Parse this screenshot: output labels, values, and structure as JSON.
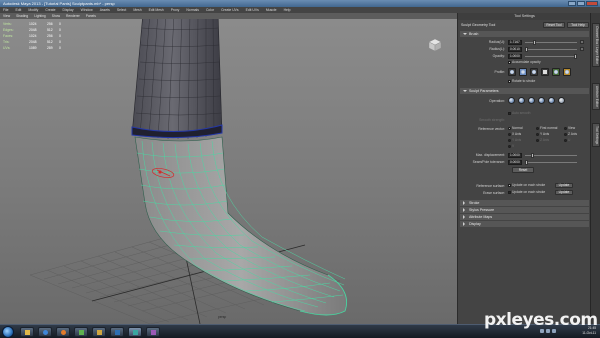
{
  "window": {
    "title": "Autodesk Maya 2013 - [Tutorial Pants] Sculptpants.mb* - persp"
  },
  "menubar": {
    "items": [
      "File",
      "Edit",
      "Modify",
      "Create",
      "Display",
      "Window",
      "Assets",
      "Select",
      "Mesh",
      "Edit Mesh",
      "Proxy",
      "Normals",
      "Color",
      "Create UVs",
      "Edit UVs",
      "Muscle",
      "Help"
    ]
  },
  "viewport": {
    "menu": [
      "View",
      "Shading",
      "Lighting",
      "Show",
      "Renderer",
      "Panels"
    ],
    "hud": [
      {
        "label": "Verts:",
        "a": "1024",
        "b": "256",
        "c": "0"
      },
      {
        "label": "Edges:",
        "a": "2048",
        "b": "512",
        "c": "0"
      },
      {
        "label": "Faces:",
        "a": "1024",
        "b": "256",
        "c": "0"
      },
      {
        "label": "Tris:",
        "a": "2048",
        "b": "512",
        "c": "0"
      },
      {
        "label": "UVs:",
        "a": "1089",
        "b": "289",
        "c": "0"
      }
    ],
    "camera_label": "persp",
    "colors": {
      "wire": "#4dd6a3",
      "selection": "#2538a8",
      "brush": "#d42a2a"
    }
  },
  "tool_settings": {
    "panel_title": "Tool Settings",
    "tool_name": "Sculpt Geometry Tool",
    "reset_tool": "Reset Tool",
    "tool_help": "Tool Help",
    "brush": {
      "header": "Brush",
      "radius_u_label": "Radius(U):",
      "radius_u_value": "1.7167",
      "radius_l_label": "Radius(L):",
      "radius_l_value": "0.0010",
      "opacity_label": "Opacity:",
      "opacity_value": "1.0000",
      "accumulate_label": "Accumulate opacity",
      "profile_label": "Profile:",
      "rotate_label": "Rotate to stroke"
    },
    "sculpt_params": {
      "header": "Sculpt Parameters",
      "operation_label": "Operation:",
      "auto_smooth_label": "Auto smooth",
      "smooth_strength_label": "Smooth strength:",
      "reference_vector_label": "Reference vector:",
      "ref_options": [
        "Normal",
        "First normal",
        "View",
        "X Axis",
        "Y Axis",
        "Z Axis",
        "Y Axis",
        "Z Axis",
        "U",
        "V"
      ],
      "max_disp_label": "Max. displacement:",
      "max_disp_value": "1.0000",
      "seam_label": "Seam/Pole tolerance:",
      "seam_value": "0.0000",
      "reset_label": "Reset"
    },
    "reference": {
      "ref_surface_label": "Reference surface:",
      "ref_surface_option": "Update on each stroke",
      "erase_surface_label": "Erase surface:",
      "erase_surface_option": "Update on each stroke",
      "update_button": "Update"
    },
    "collapsed": [
      "Stroke",
      "Stylus Pressure",
      "Attribute Maps",
      "Display"
    ]
  },
  "side_tabs": [
    "Channel Box / Layer Editor",
    "Attribute Editor",
    "Tool Settings"
  ],
  "taskbar": {
    "time": "21:45",
    "date": "11-Oct-11"
  },
  "watermark": "pxleyes.com"
}
